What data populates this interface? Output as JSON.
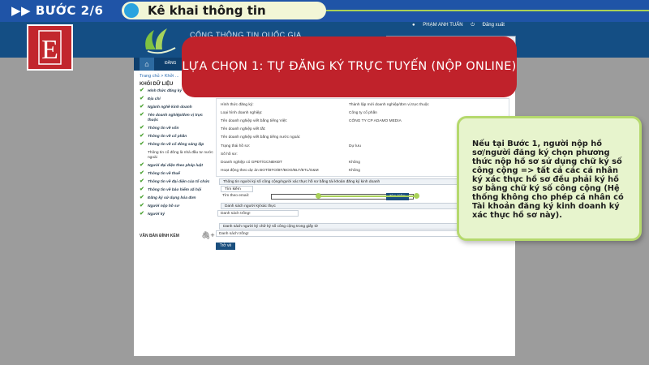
{
  "step": {
    "label": "BƯỚC 2/6",
    "title": "Kê khai thông tin"
  },
  "portal": {
    "name": "CỔNG THÔNG TIN QUỐC GIA",
    "user": "PHẠM ANH TUẤN",
    "logout": "Đăng xuất",
    "nav_item": "ĐĂNG"
  },
  "breadcrumb": "Trang chủ > Khởi ...",
  "sidebar": {
    "title": "KHỐI DỮ LIỆU",
    "items": [
      "Hình thức đăng ký",
      "Địa chỉ",
      "Ngành nghề kinh doanh",
      "Tên doanh nghiệp/đơn vị trực thuộc",
      "Thông tin về vốn",
      "Thông tin về cổ phần",
      "Thông tin về cổ đông sáng lập",
      "Thông tin cổ đông là nhà đầu tư nước ngoài",
      "Người đại diện theo pháp luật",
      "Thông tin về thuế",
      "Thông tin về đại diện của tổ chức",
      "Thông tin về bảo hiểm xã hội",
      "Đăng ký sử dụng hóa đơn",
      "Người nộp hồ sơ",
      "Người ký"
    ],
    "attachments": "VĂN BẢN ĐÍNH KÈM"
  },
  "form": {
    "rows": [
      {
        "label": "Hình thức đăng ký:",
        "value": "Thành lập mới doanh nghiệp/đơn vị trực thuộc"
      },
      {
        "label": "Loại hình doanh nghiệp:",
        "value": "Công ty cổ phần"
      },
      {
        "label": "Tên doanh nghiệp viết bằng tiếng Việt:",
        "value": "CÔNG TY CP ADAMO MEDIA"
      },
      {
        "label": "Tên doanh nghiệp viết tắt:",
        "value": ""
      },
      {
        "label": "Tên doanh nghiệp viết bằng tiếng nước ngoài:",
        "value": ""
      },
      {
        "label": "Trạng thái hồ sơ:",
        "value": "Dự lưu"
      },
      {
        "label": "Số hồ sơ:",
        "value": ""
      },
      {
        "label": "Doanh nghiệp có GPĐT/GCNĐKĐT",
        "value": "Không"
      },
      {
        "label": "Hoạt động theo dự án BOT/BTO/BT/BOO/BLT/BTL/O&M",
        "value": "Không"
      }
    ],
    "signer_section": "Thông tin người ký số công cộng/người xác thực hồ sơ bằng tài khoản đăng ký kinh doanh",
    "search_label": "Tìm kiếm",
    "email_label": "Tìm theo email:",
    "find_button": "Tìm kiếm",
    "signer_list_head": "Danh sách người ký/xác thực",
    "empty_list": "Danh sách trống!",
    "public_sign_head": "Danh sách người ký chữ ký số công cộng trong giấy tờ",
    "empty_list_2": "Danh sách trống!",
    "back_button": "Trở về"
  },
  "banner": "LỰA CHỌN 1: TỰ ĐĂNG KÝ TRỰC TUYẾN (NỘP ONLINE)",
  "note": "Nếu tại Bước 1, người nộp hồ sơ/người đăng ký chọn phương thức nộp hồ sơ sử dụng chữ ký số công cộng => tất cả các cá nhân ký xác thực hồ sơ đều phải ký hồ sơ bằng chữ ký số công cộng (Hệ thống không cho phép cá nhân có Tài khoản đăng ký kinh doanh ký xác thực hồ sơ này).",
  "colors": {
    "brand_red": "#c0222b",
    "step_blue": "#1f54a7",
    "accent_green": "#a9d159",
    "portal_blue": "#144e84"
  },
  "icons": [
    "play-forward-icon",
    "home-icon",
    "user-icon",
    "logout-icon",
    "check-icon",
    "attachment-icon",
    "e-logo"
  ]
}
